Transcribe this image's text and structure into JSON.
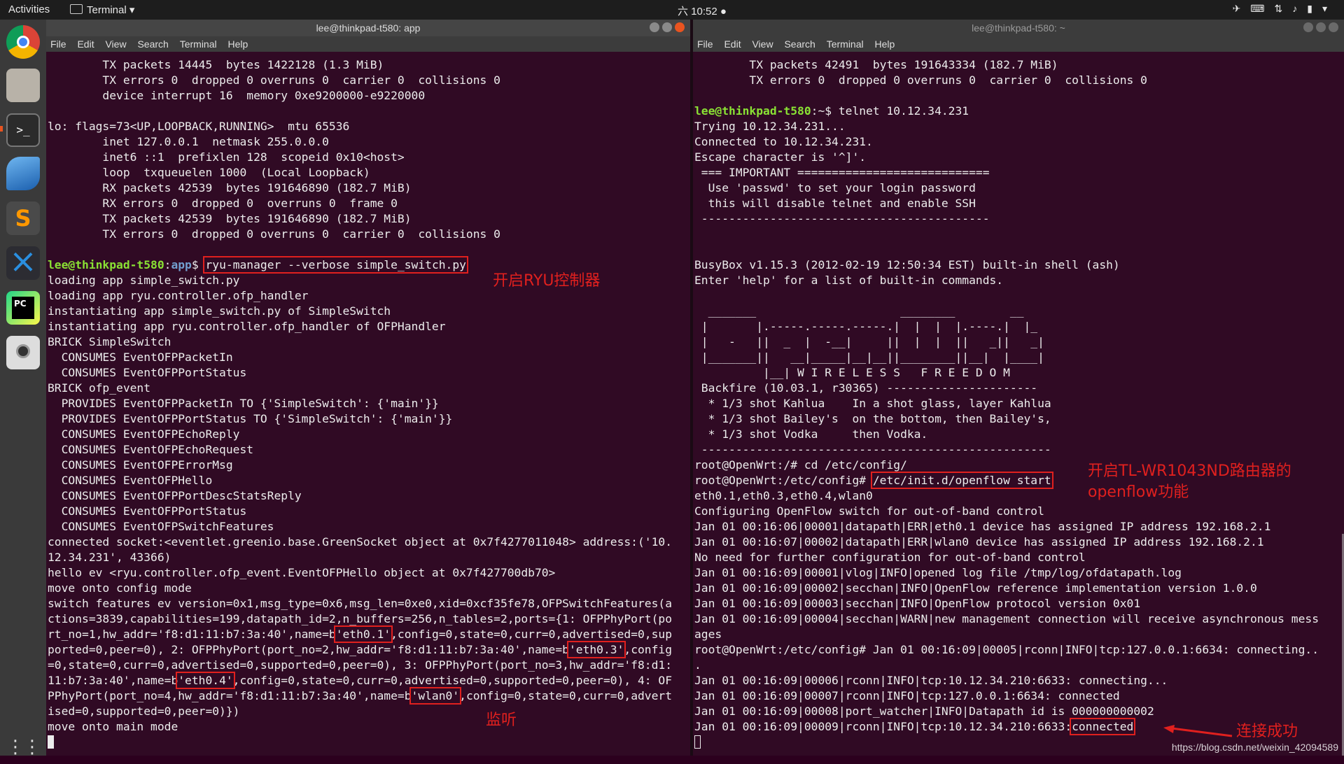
{
  "topbar": {
    "activities": "Activities",
    "app_menu": "Terminal ▾",
    "clock": "六 10:52 ●",
    "tray_icons": [
      "telegram-icon",
      "keyboard-icon",
      "network-icon",
      "volume-icon",
      "battery-icon",
      "power-menu-icon"
    ]
  },
  "dock": [
    "chrome-icon",
    "files-icon",
    "terminal-icon",
    "wireshark-icon",
    "sublime-icon",
    "vscode-icon",
    "pycharm-icon",
    "camera-icon",
    "app-grid-icon"
  ],
  "left_window": {
    "title": "lee@thinkpad-t580: app",
    "menu": [
      "File",
      "Edit",
      "View",
      "Search",
      "Terminal",
      "Help"
    ],
    "lines_top": [
      "        TX packets 14445  bytes 1422128 (1.3 MiB)",
      "        TX errors 0  dropped 0 overruns 0  carrier 0  collisions 0",
      "        device interrupt 16  memory 0xe9200000-e9220000",
      "",
      "lo: flags=73<UP,LOOPBACK,RUNNING>  mtu 65536",
      "        inet 127.0.0.1  netmask 255.0.0.0",
      "        inet6 ::1  prefixlen 128  scopeid 0x10<host>",
      "        loop  txqueuelen 1000  (Local Loopback)",
      "        RX packets 42539  bytes 191646890 (182.7 MiB)",
      "        RX errors 0  dropped 0  overruns 0  frame 0",
      "        TX packets 42539  bytes 191646890 (182.7 MiB)",
      "        TX errors 0  dropped 0 overruns 0  carrier 0  collisions 0",
      ""
    ],
    "prompt_user": "lee@thinkpad-t580",
    "prompt_sep": ":",
    "prompt_path": "app",
    "prompt_end": "$ ",
    "command": "ryu-manager --verbose simple_switch.py",
    "lines_mid": [
      "loading app simple_switch.py",
      "loading app ryu.controller.ofp_handler",
      "instantiating app simple_switch.py of SimpleSwitch",
      "instantiating app ryu.controller.ofp_handler of OFPHandler",
      "BRICK SimpleSwitch",
      "  CONSUMES EventOFPPacketIn",
      "  CONSUMES EventOFPPortStatus",
      "BRICK ofp_event",
      "  PROVIDES EventOFPPacketIn TO {'SimpleSwitch': {'main'}}",
      "  PROVIDES EventOFPPortStatus TO {'SimpleSwitch': {'main'}}",
      "  CONSUMES EventOFPEchoReply",
      "  CONSUMES EventOFPEchoRequest",
      "  CONSUMES EventOFPErrorMsg",
      "  CONSUMES EventOFPHello",
      "  CONSUMES EventOFPPortDescStatsReply",
      "  CONSUMES EventOFPPortStatus",
      "  CONSUMES EventOFPSwitchFeatures",
      "connected socket:<eventlet.greenio.base.GreenSocket object at 0x7f4277011048> address:('10.",
      "12.34.231', 43366)",
      "hello ev <ryu.controller.ofp_event.EventOFPHello object at 0x7f427700db70>",
      "move onto config mode",
      "switch features ev version=0x1,msg_type=0x6,msg_len=0xe0,xid=0xcf35fe78,OFPSwitchFeatures(a",
      "ctions=3839,capabilities=199,datapath_id=2,n_buffers=256,n_tables=2,ports={1: OFPPhyPort(po"
    ],
    "port_lines": [
      [
        "rt_no=1,hw_addr='f8:d1:11:b7:3a:40',name=b",
        "'eth0.1'",
        ",config=0,state=0,curr=0,advertised=0,sup"
      ],
      [
        "ported=0,peer=0), 2: OFPPhyPort(port_no=2,hw_addr='f8:d1:11:b7:3a:40',name=b",
        "'eth0.3'",
        ",config"
      ],
      [
        "=0,state=0,curr=0,advertised=0,supported=0,peer=0), 3: OFPPhyPort(port_no=3,hw_addr='f8:d1:",
        "",
        ""
      ],
      [
        "11:b7:3a:40',name=b",
        "'eth0.4'",
        ",config=0,state=0,curr=0,advertised=0,supported=0,peer=0), 4: OF"
      ],
      [
        "PPhyPort(port_no=4,hw_addr='f8:d1:11:b7:3a:40',name=b",
        "'wlan0'",
        ",config=0,state=0,curr=0,advert"
      ]
    ],
    "lines_end": [
      "ised=0,supported=0,peer=0)})",
      "move onto main mode"
    ]
  },
  "right_window": {
    "title": "lee@thinkpad-t580: ~",
    "menu": [
      "File",
      "Edit",
      "View",
      "Search",
      "Terminal",
      "Help"
    ],
    "lines_top": [
      "        TX packets 42491  bytes 191643334 (182.7 MiB)",
      "        TX errors 0  dropped 0 overruns 0  carrier 0  collisions 0",
      ""
    ],
    "prompt_user": "lee@thinkpad-t580",
    "prompt_rest": ":~$ telnet 10.12.34.231",
    "lines_mid": [
      "Trying 10.12.34.231...",
      "Connected to 10.12.34.231.",
      "Escape character is '^]'.",
      " === IMPORTANT ============================",
      "  Use 'passwd' to set your login password",
      "  this will disable telnet and enable SSH",
      " ------------------------------------------",
      "",
      "",
      "BusyBox v1.15.3 (2012-02-19 12:50:34 EST) built-in shell (ash)",
      "Enter 'help' for a list of built-in commands.",
      "",
      "  _______                     ________        __",
      " |       |.-----.-----.-----.|  |  |  |.----.|  |_",
      " |   -   ||  _  |  -__|     ||  |  |  ||   _||   _|",
      " |_______||   __|_____|__|__||________||__|  |____|",
      "          |__| W I R E L E S S   F R E E D O M",
      " Backfire (10.03.1, r30365) ----------------------",
      "  * 1/3 shot Kahlua    In a shot glass, layer Kahlua",
      "  * 1/3 shot Bailey's  on the bottom, then Bailey's,",
      "  * 1/3 shot Vodka     then Vodka.",
      " ---------------------------------------------------",
      "root@OpenWrt:/# cd /etc/config/"
    ],
    "root_prompt": "root@OpenWrt:/etc/config# ",
    "openflow_cmd": "/etc/init.d/openflow start",
    "lines_log": [
      "eth0.1,eth0.3,eth0.4,wlan0",
      "Configuring OpenFlow switch for out-of-band control",
      "Jan 01 00:16:06|00001|datapath|ERR|eth0.1 device has assigned IP address 192.168.2.1",
      "Jan 01 00:16:07|00002|datapath|ERR|wlan0 device has assigned IP address 192.168.2.1",
      "No need for further configuration for out-of-band control",
      "Jan 01 00:16:09|00001|vlog|INFO|opened log file /tmp/log/ofdatapath.log",
      "Jan 01 00:16:09|00002|secchan|INFO|OpenFlow reference implementation version 1.0.0",
      "Jan 01 00:16:09|00003|secchan|INFO|OpenFlow protocol version 0x01",
      "Jan 01 00:16:09|00004|secchan|WARN|new management connection will receive asynchronous mess",
      "ages",
      "root@OpenWrt:/etc/config# Jan 01 00:16:09|00005|rconn|INFO|tcp:127.0.0.1:6634: connecting..",
      ".",
      "Jan 01 00:16:09|00006|rconn|INFO|tcp:10.12.34.210:6633: connecting...",
      "Jan 01 00:16:09|00007|rconn|INFO|tcp:127.0.0.1:6634: connected",
      "Jan 01 00:16:09|00008|port_watcher|INFO|Datapath id is 000000000002"
    ],
    "last_line_prefix": "Jan 01 00:16:09|00009|rconn|INFO|tcp:10.12.34.210:6633:",
    "last_line_status": "connected"
  },
  "annotations": {
    "start_ryu": "开启RYU控制器",
    "listen": "监听",
    "openflow_line1": "开启TL-WR1043ND路由器的",
    "openflow_line2": "openflow功能",
    "connected_ok": "连接成功"
  },
  "watermark": "https://blog.csdn.net/weixin_42094589",
  "colors": {
    "terminal_bg": "#300a24",
    "prompt_user": "#8ae234",
    "prompt_path": "#729fcf",
    "annotation_red": "#e0201e"
  }
}
